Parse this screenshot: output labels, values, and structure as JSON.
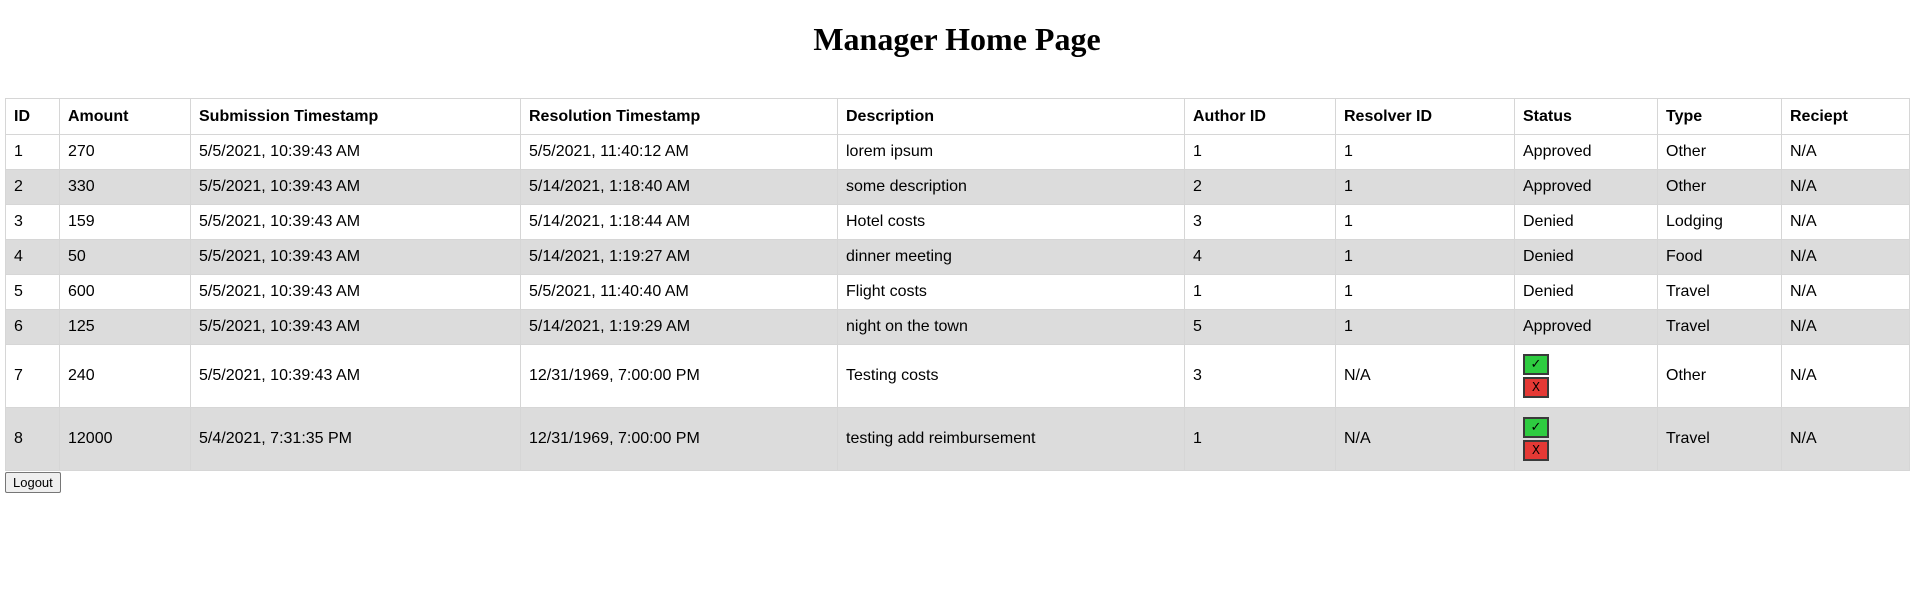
{
  "page": {
    "title": "Manager Home Page"
  },
  "table": {
    "headers": [
      "ID",
      "Amount",
      "Submission Timestamp",
      "Resolution Timestamp",
      "Description",
      "Author ID",
      "Resolver ID",
      "Status",
      "Type",
      "Reciept"
    ],
    "rows": [
      {
        "id": "1",
        "amount": "270",
        "submitted": "5/5/2021, 10:39:43 AM",
        "resolved": "5/5/2021, 11:40:12 AM",
        "description": "lorem ipsum",
        "author": "1",
        "resolver": "1",
        "status": "Approved",
        "type": "Other",
        "receipt": "N/A"
      },
      {
        "id": "2",
        "amount": "330",
        "submitted": "5/5/2021, 10:39:43 AM",
        "resolved": "5/14/2021, 1:18:40 AM",
        "description": "some description",
        "author": "2",
        "resolver": "1",
        "status": "Approved",
        "type": "Other",
        "receipt": "N/A"
      },
      {
        "id": "3",
        "amount": "159",
        "submitted": "5/5/2021, 10:39:43 AM",
        "resolved": "5/14/2021, 1:18:44 AM",
        "description": "Hotel costs",
        "author": "3",
        "resolver": "1",
        "status": "Denied",
        "type": "Lodging",
        "receipt": "N/A"
      },
      {
        "id": "4",
        "amount": "50",
        "submitted": "5/5/2021, 10:39:43 AM",
        "resolved": "5/14/2021, 1:19:27 AM",
        "description": "dinner meeting",
        "author": "4",
        "resolver": "1",
        "status": "Denied",
        "type": "Food",
        "receipt": "N/A"
      },
      {
        "id": "5",
        "amount": "600",
        "submitted": "5/5/2021, 10:39:43 AM",
        "resolved": "5/5/2021, 11:40:40 AM",
        "description": "Flight costs",
        "author": "1",
        "resolver": "1",
        "status": "Denied",
        "type": "Travel",
        "receipt": "N/A"
      },
      {
        "id": "6",
        "amount": "125",
        "submitted": "5/5/2021, 10:39:43 AM",
        "resolved": "5/14/2021, 1:19:29 AM",
        "description": "night on the town",
        "author": "5",
        "resolver": "1",
        "status": "Approved",
        "type": "Travel",
        "receipt": "N/A"
      },
      {
        "id": "7",
        "amount": "240",
        "submitted": "5/5/2021, 10:39:43 AM",
        "resolved": "12/31/1969, 7:00:00 PM",
        "description": "Testing costs",
        "author": "3",
        "resolver": "N/A",
        "status": null,
        "type": "Other",
        "receipt": "N/A"
      },
      {
        "id": "8",
        "amount": "12000",
        "submitted": "5/4/2021, 7:31:35 PM",
        "resolved": "12/31/1969, 7:00:00 PM",
        "description": "testing add reimbursement",
        "author": "1",
        "resolver": "N/A",
        "status": null,
        "type": "Travel",
        "receipt": "N/A"
      }
    ]
  },
  "actions": {
    "approve_label": "✓",
    "deny_label": "X"
  },
  "logout_label": "Logout",
  "colors": {
    "approve": "#2ecc40",
    "deny": "#e53935",
    "row_alt": "#dcdcdc"
  }
}
